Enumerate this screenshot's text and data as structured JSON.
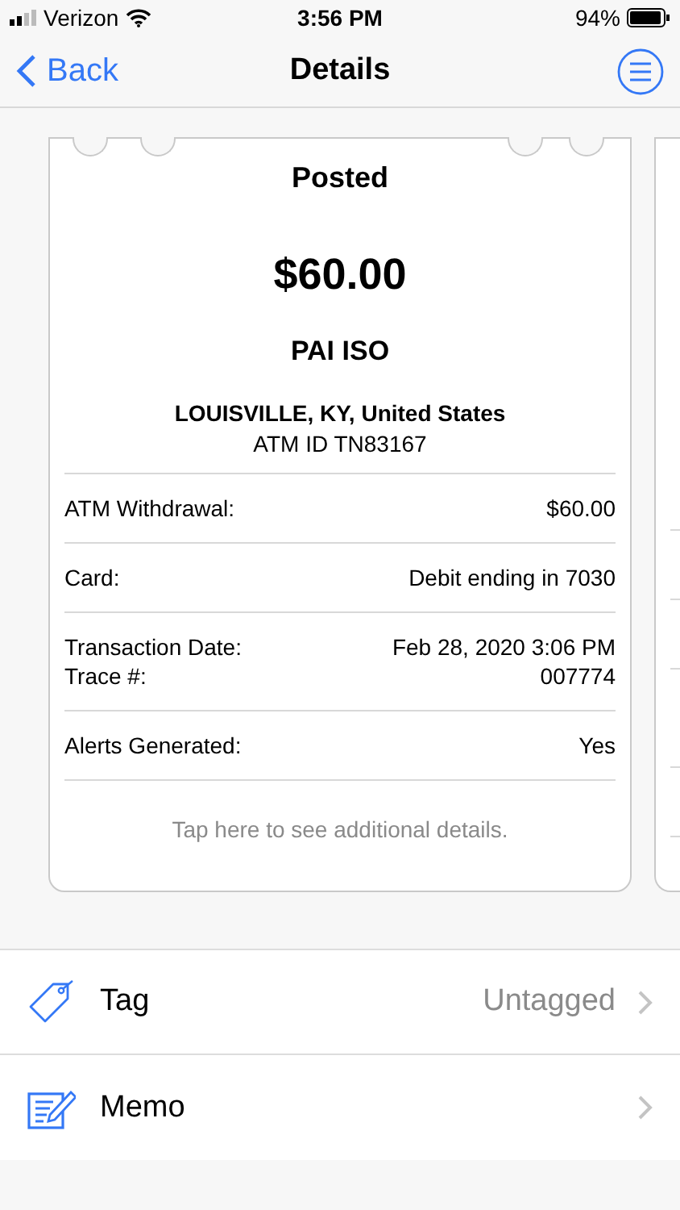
{
  "status_bar": {
    "carrier": "Verizon",
    "time": "3:56 PM",
    "battery": "94%"
  },
  "nav": {
    "back": "Back",
    "title": "Details"
  },
  "card": {
    "status": "Posted",
    "amount": "$60.00",
    "merchant": "PAI ISO",
    "location": "LOUISVILLE, KY, United States",
    "atm_id": "ATM ID TN83167",
    "rows": [
      {
        "labels": [
          "ATM Withdrawal:"
        ],
        "values": [
          "$60.00"
        ]
      },
      {
        "labels": [
          "Card:"
        ],
        "values": [
          "Debit ending in 7030"
        ]
      },
      {
        "labels": [
          "Transaction Date:",
          "Trace #:"
        ],
        "values": [
          "Feb 28, 2020 3:06 PM",
          "007774"
        ]
      },
      {
        "labels": [
          "Alerts Generated:"
        ],
        "values": [
          "Yes"
        ]
      }
    ],
    "footer": "Tap here to see additional details."
  },
  "options": [
    {
      "kind": "tag",
      "label": "Tag",
      "value": "Untagged"
    },
    {
      "kind": "memo",
      "label": "Memo"
    }
  ]
}
